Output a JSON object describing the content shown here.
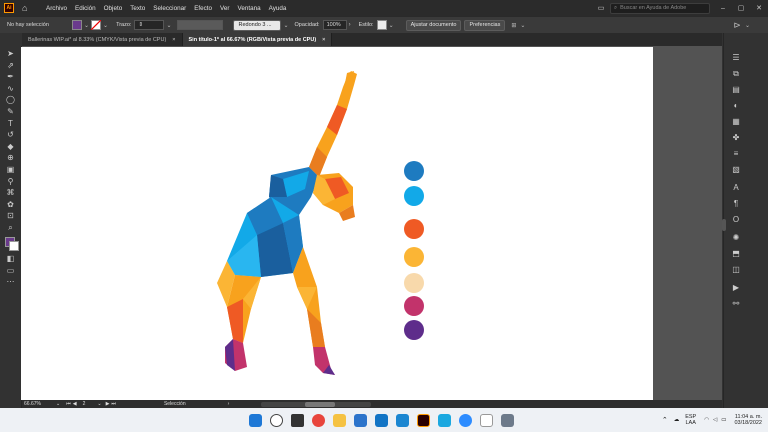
{
  "app": {
    "logo_text": "Ai",
    "home_icon": "home-icon"
  },
  "menu": [
    "Archivo",
    "Edición",
    "Objeto",
    "Texto",
    "Seleccionar",
    "Efecto",
    "Ver",
    "Ventana",
    "Ayuda"
  ],
  "search": {
    "placeholder": "Buscar en Ayuda de Adobe"
  },
  "control_bar": {
    "selection_state": "No hay selección",
    "fill_color": "#6a3a8c",
    "stroke_label": "Trazo:",
    "brush_label": "Redondo 3 ...",
    "opacity_label": "Opacidad:",
    "opacity_value": "100%",
    "style_label": "Estilo:",
    "fit_doc_button": "Ajustar documento",
    "prefs_button": "Preferencias"
  },
  "tabs": [
    {
      "label": "Ballerinas WIP.ai* al 8.33% (CMYK/Vista previa de CPU)",
      "close": "×",
      "active": false
    },
    {
      "label": "Sin título-1* al 66.67% (RGB/Vista previa de CPU)",
      "close": "×",
      "active": true
    }
  ],
  "palette": [
    {
      "name": "blue",
      "color": "#1e7bc0"
    },
    {
      "name": "cyan",
      "color": "#12a9e8"
    },
    {
      "name": "orange",
      "color": "#ef5a24"
    },
    {
      "name": "yellow",
      "color": "#fbb535"
    },
    {
      "name": "cream",
      "color": "#f8d9ab"
    },
    {
      "name": "magenta",
      "color": "#c2336b"
    },
    {
      "name": "purple",
      "color": "#5e2d8b"
    }
  ],
  "status": {
    "zoom": "66.67%",
    "page": "2",
    "tool": "Selección"
  },
  "taskbar": {
    "lang": "ESP",
    "layout": "LAA",
    "time": "11:04 a. m.",
    "date": "03/18/2022"
  }
}
